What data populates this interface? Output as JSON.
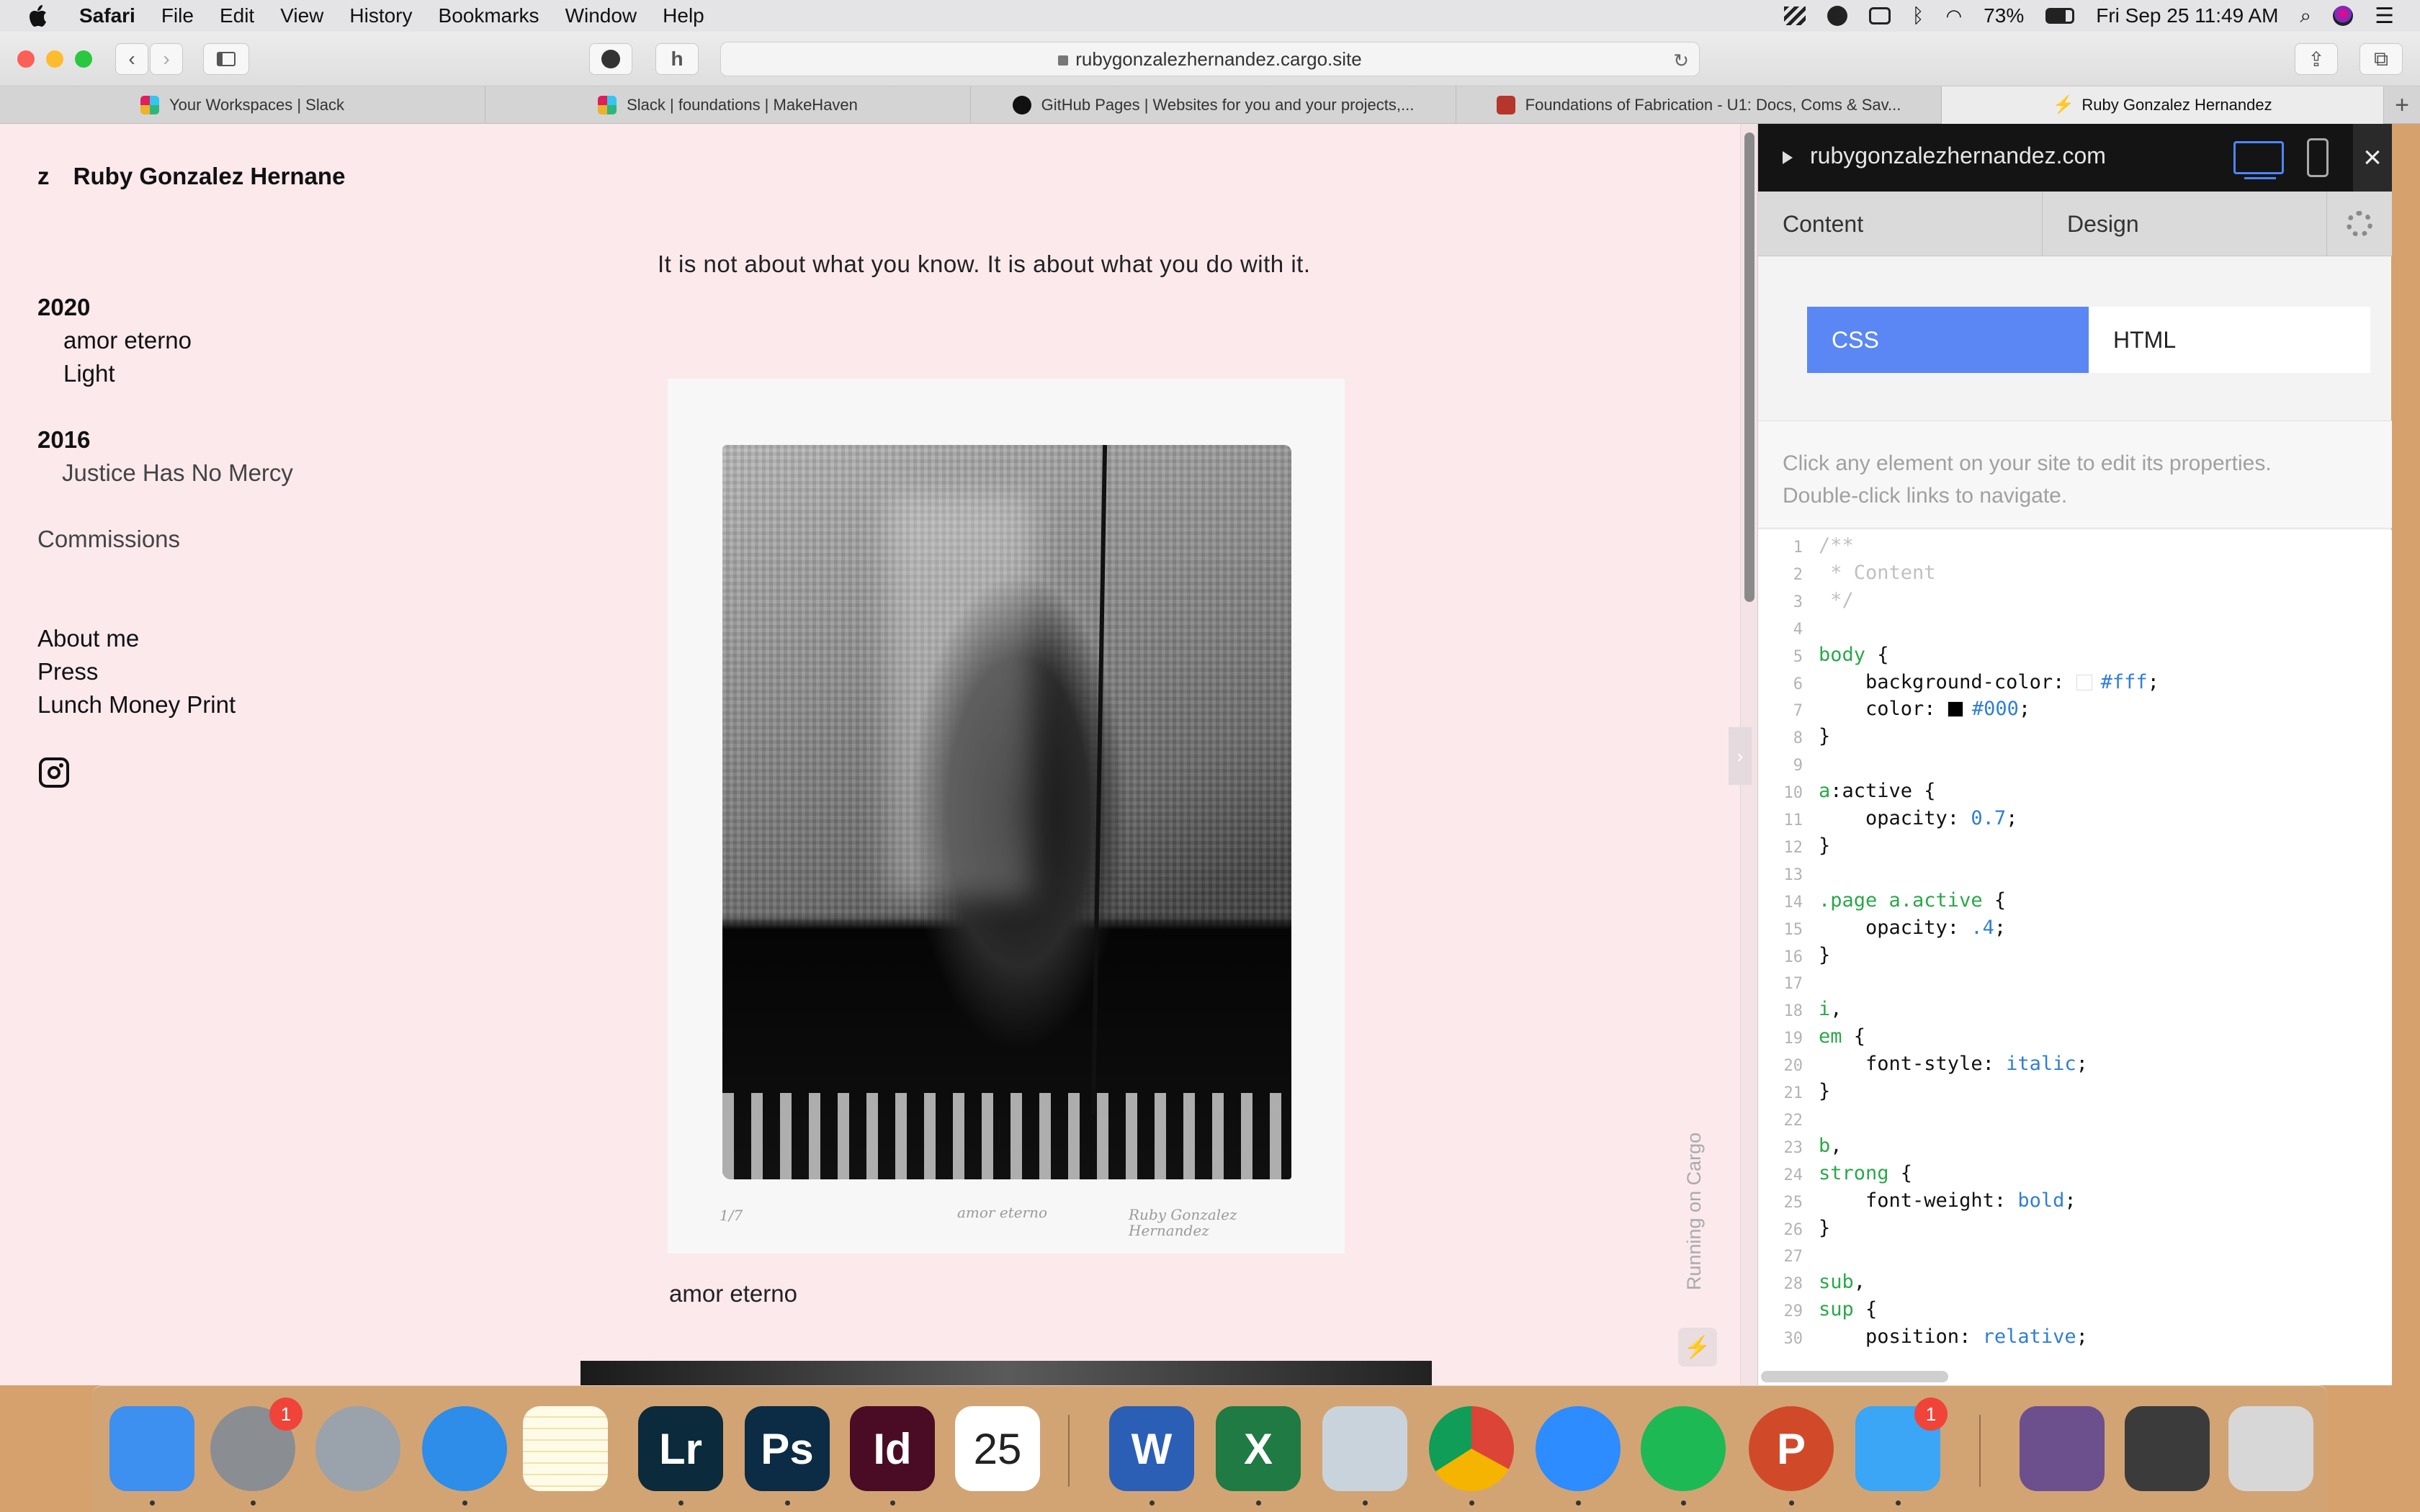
{
  "menubar": {
    "app": "Safari",
    "items": [
      "File",
      "Edit",
      "View",
      "History",
      "Bookmarks",
      "Window",
      "Help"
    ],
    "battery": "73%",
    "datetime": "Fri Sep 25  11:49 AM"
  },
  "browser": {
    "url": "rubygonzalezhernandez.cargo.site",
    "tabs": [
      {
        "title": "Your Workspaces | Slack",
        "icon_color": "#e01e5a"
      },
      {
        "title": "Slack | foundations | MakeHaven",
        "icon_color": "#36c5f0"
      },
      {
        "title": "GitHub Pages | Websites for you and your projects,...",
        "icon_color": "#111111"
      },
      {
        "title": "Foundations of Fabrication - U1: Docs, Coms & Sav...",
        "icon_color": "#b5362a"
      },
      {
        "title": "Ruby Gonzalez Hernandez",
        "icon_color": "#222222"
      }
    ]
  },
  "site": {
    "title_prefix": "z",
    "title": "Ruby Gonzalez Hernane",
    "nav": {
      "year_2020": "2020",
      "items_2020": [
        "amor eterno",
        "Light"
      ],
      "year_2016": "2016",
      "items_2016": [
        "Justice Has No Mercy"
      ],
      "commissions": "Commissions",
      "about": "About me",
      "press": "Press",
      "lunch": "Lunch Money Print"
    },
    "tagline": "It is not about what you know. It is about what you do with it.",
    "print_marks": {
      "edition": "1/7",
      "title": "amor eterno",
      "signature": "Ruby Gonzalez Hernandez"
    },
    "caption": "amor eterno",
    "running": "Running on Cargo"
  },
  "editor": {
    "site": "rubygonzalezhernandez.com",
    "tabs": {
      "content": "Content",
      "design": "Design"
    },
    "switch": {
      "css": "CSS",
      "html": "HTML"
    },
    "help_line1": "Click any element on your site to edit its properties.",
    "help_line2": "Double-click links to navigate.",
    "code_lines": [
      {
        "n": "1",
        "parts": [
          {
            "c": "com",
            "t": "/**"
          }
        ]
      },
      {
        "n": "2",
        "parts": [
          {
            "c": "com",
            "t": " * Content"
          }
        ]
      },
      {
        "n": "3",
        "parts": [
          {
            "c": "com",
            "t": " */"
          }
        ]
      },
      {
        "n": "4",
        "parts": []
      },
      {
        "n": "5",
        "parts": [
          {
            "c": "sel",
            "t": "body"
          },
          {
            "c": "pun",
            "t": " {"
          }
        ]
      },
      {
        "n": "6",
        "parts": [
          {
            "c": "pun",
            "t": "    background-color: "
          },
          {
            "c": "swatch",
            "t": "#ffffff"
          },
          {
            "c": "val",
            "t": "#fff"
          },
          {
            "c": "pun",
            "t": ";"
          }
        ]
      },
      {
        "n": "7",
        "parts": [
          {
            "c": "pun",
            "t": "    color: "
          },
          {
            "c": "swatch",
            "t": "#000000"
          },
          {
            "c": "val",
            "t": "#000"
          },
          {
            "c": "pun",
            "t": ";"
          }
        ]
      },
      {
        "n": "8",
        "parts": [
          {
            "c": "pun",
            "t": "}"
          }
        ]
      },
      {
        "n": "9",
        "parts": []
      },
      {
        "n": "10",
        "parts": [
          {
            "c": "sel",
            "t": "a"
          },
          {
            "c": "pun",
            "t": ":active {"
          }
        ]
      },
      {
        "n": "11",
        "parts": [
          {
            "c": "pun",
            "t": "    opacity: "
          },
          {
            "c": "val",
            "t": "0.7"
          },
          {
            "c": "pun",
            "t": ";"
          }
        ]
      },
      {
        "n": "12",
        "parts": [
          {
            "c": "pun",
            "t": "}"
          }
        ]
      },
      {
        "n": "13",
        "parts": []
      },
      {
        "n": "14",
        "parts": [
          {
            "c": "sel",
            "t": ".page a.active"
          },
          {
            "c": "pun",
            "t": " {"
          }
        ]
      },
      {
        "n": "15",
        "parts": [
          {
            "c": "pun",
            "t": "    opacity: "
          },
          {
            "c": "val",
            "t": ".4"
          },
          {
            "c": "pun",
            "t": ";"
          }
        ]
      },
      {
        "n": "16",
        "parts": [
          {
            "c": "pun",
            "t": "}"
          }
        ]
      },
      {
        "n": "17",
        "parts": []
      },
      {
        "n": "18",
        "parts": [
          {
            "c": "sel",
            "t": "i"
          },
          {
            "c": "pun",
            "t": ","
          }
        ]
      },
      {
        "n": "19",
        "parts": [
          {
            "c": "sel",
            "t": "em"
          },
          {
            "c": "pun",
            "t": " {"
          }
        ]
      },
      {
        "n": "20",
        "parts": [
          {
            "c": "pun",
            "t": "    font-style: "
          },
          {
            "c": "val",
            "t": "italic"
          },
          {
            "c": "pun",
            "t": ";"
          }
        ]
      },
      {
        "n": "21",
        "parts": [
          {
            "c": "pun",
            "t": "}"
          }
        ]
      },
      {
        "n": "22",
        "parts": []
      },
      {
        "n": "23",
        "parts": [
          {
            "c": "sel",
            "t": "b"
          },
          {
            "c": "pun",
            "t": ","
          }
        ]
      },
      {
        "n": "24",
        "parts": [
          {
            "c": "sel",
            "t": "strong"
          },
          {
            "c": "pun",
            "t": " {"
          }
        ]
      },
      {
        "n": "25",
        "parts": [
          {
            "c": "pun",
            "t": "    font-weight: "
          },
          {
            "c": "val",
            "t": "bold"
          },
          {
            "c": "pun",
            "t": ";"
          }
        ]
      },
      {
        "n": "26",
        "parts": [
          {
            "c": "pun",
            "t": "}"
          }
        ]
      },
      {
        "n": "27",
        "parts": []
      },
      {
        "n": "28",
        "parts": [
          {
            "c": "sel",
            "t": "sub"
          },
          {
            "c": "pun",
            "t": ","
          }
        ]
      },
      {
        "n": "29",
        "parts": [
          {
            "c": "sel",
            "t": "sup"
          },
          {
            "c": "pun",
            "t": " {"
          }
        ]
      },
      {
        "n": "30",
        "parts": [
          {
            "c": "pun",
            "t": "    position: "
          },
          {
            "c": "val",
            "t": "relative"
          },
          {
            "c": "pun",
            "t": ";"
          }
        ]
      }
    ]
  },
  "dock": {
    "apps": [
      {
        "name": "finder-icon",
        "label": "",
        "color": "#3d8ff0",
        "running": true
      },
      {
        "name": "system-preferences-icon",
        "label": "",
        "color": "#8a8d92",
        "badge": "1",
        "running": true
      },
      {
        "name": "launchpad-icon",
        "label": "",
        "color": "#9aa2ab",
        "running": false
      },
      {
        "name": "safari-icon",
        "label": "",
        "color": "#2d8de8",
        "running": true
      },
      {
        "name": "notes-icon",
        "label": "",
        "color": "#f7e27a",
        "running": false
      },
      {
        "name": "lightroom-icon",
        "label": "Lr",
        "color": "#0b2a3b",
        "running": true
      },
      {
        "name": "photoshop-icon",
        "label": "Ps",
        "color": "#0c2b44",
        "running": true
      },
      {
        "name": "indesign-icon",
        "label": "Id",
        "color": "#4a0c25",
        "running": true
      },
      {
        "name": "calendar-icon",
        "label": "25",
        "color": "#ffffff",
        "running": false
      },
      {
        "name": "word-icon",
        "label": "W",
        "color": "#2b5fb5",
        "running": true
      },
      {
        "name": "excel-icon",
        "label": "X",
        "color": "#1f7a43",
        "running": true
      },
      {
        "name": "preview-icon",
        "label": "",
        "color": "#c9d3dc",
        "running": true
      },
      {
        "name": "chrome-icon",
        "label": "",
        "color": "#e8a93a",
        "running": true
      },
      {
        "name": "zoom-icon",
        "label": "",
        "color": "#2d8cff",
        "running": true
      },
      {
        "name": "spotify-icon",
        "label": "",
        "color": "#1db954",
        "running": true
      },
      {
        "name": "powerpoint-icon",
        "label": "P",
        "color": "#d04a2a",
        "running": true
      },
      {
        "name": "messages-icon",
        "label": "",
        "color": "#3aa6f5",
        "badge": "1",
        "running": true
      },
      {
        "name": "image-thumbnail-icon",
        "label": "",
        "color": "#6c4f8d",
        "running": false
      },
      {
        "name": "indesign-doc-icon",
        "label": "",
        "color": "#3b3b3b",
        "running": false
      },
      {
        "name": "trash-icon",
        "label": "",
        "color": "#d7d7d7",
        "running": false
      }
    ]
  }
}
